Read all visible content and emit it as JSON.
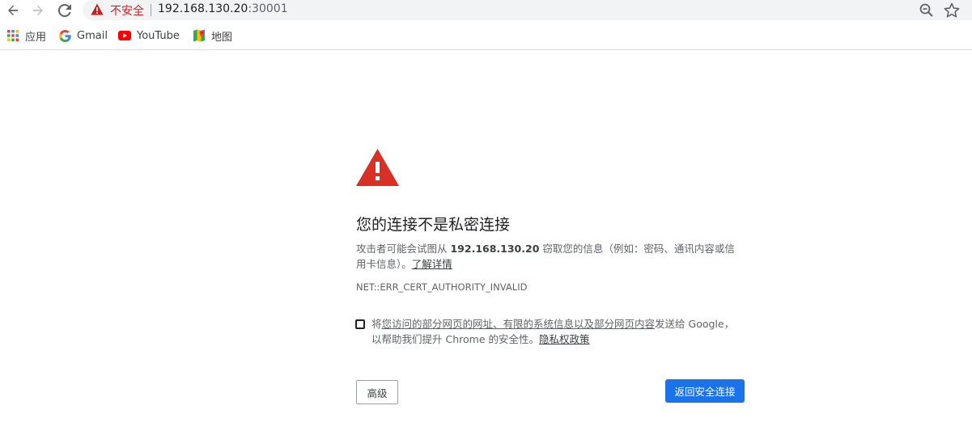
{
  "toolbar": {
    "back_icon": "back-arrow-icon",
    "forward_icon": "forward-arrow-icon",
    "reload_icon": "reload-icon",
    "security_label": "不安全",
    "url_host": "192.168.130.20",
    "url_port": ":30001",
    "zoom_icon": "zoom-icon",
    "bookmark_star_icon": "star-icon"
  },
  "bookmarks": [
    {
      "label": "应用",
      "icon": "apps-grid-icon"
    },
    {
      "label": "Gmail",
      "icon": "google-g-icon"
    },
    {
      "label": "YouTube",
      "icon": "youtube-icon"
    },
    {
      "label": "地图",
      "icon": "maps-icon"
    }
  ],
  "interstitial": {
    "title": "您的连接不是私密连接",
    "desc_prefix": "攻击者可能会试图从 ",
    "desc_host": "192.168.130.20",
    "desc_suffix": " 窃取您的信息（例如：密码、通讯内容或信用卡信息）。",
    "learn_more": "了解详情",
    "error_code": "NET::ERR_CERT_AUTHORITY_INVALID",
    "optin_prefix": "将",
    "optin_underlined": "您访问的部分网页的网址、有限的系统信息以及部分网页内容",
    "optin_middle": "发送给 Google，以帮助我们提升 Chrome 的安全性。",
    "privacy_policy": "隐私权政策",
    "advanced_button": "高级",
    "back_button": "返回安全连接"
  },
  "colors": {
    "danger_red": "#d93025",
    "primary_blue": "#1a73e8"
  }
}
